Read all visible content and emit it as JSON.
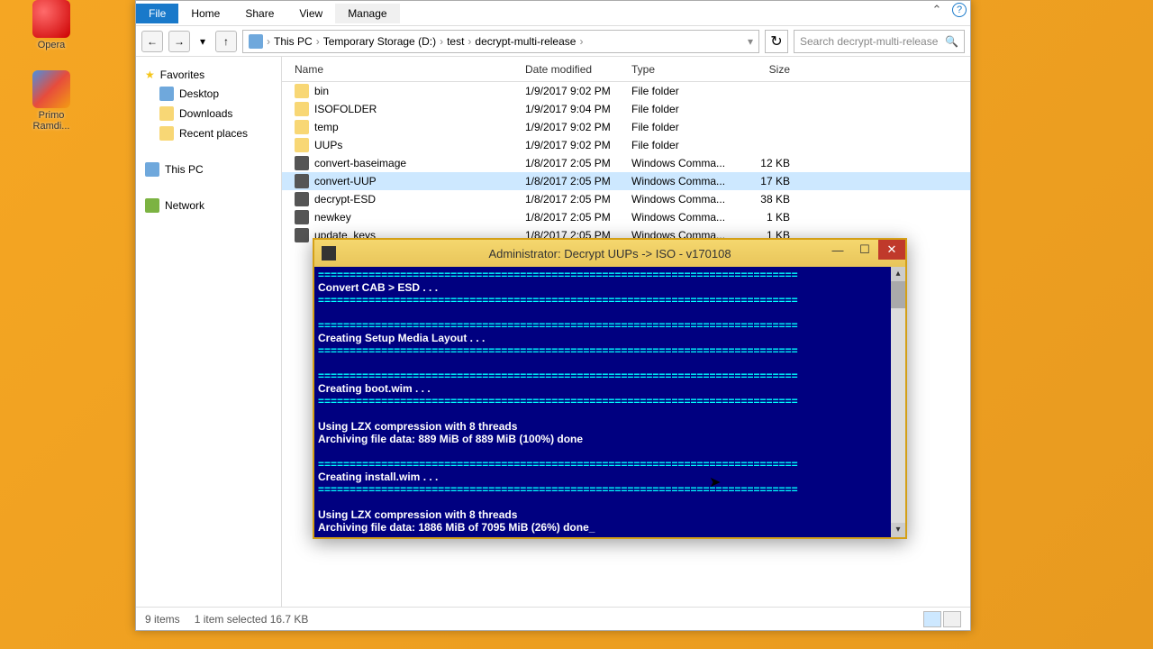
{
  "desktop": {
    "icons": [
      {
        "label": "Opera"
      },
      {
        "label": "Primo Ramdi..."
      }
    ]
  },
  "explorer": {
    "ribbon": {
      "file": "File",
      "home": "Home",
      "share": "Share",
      "view": "View",
      "manage": "Manage"
    },
    "breadcrumb": [
      "This PC",
      "Temporary Storage (D:)",
      "test",
      "decrypt-multi-release"
    ],
    "search_placeholder": "Search decrypt-multi-release",
    "columns": {
      "name": "Name",
      "date": "Date modified",
      "type": "Type",
      "size": "Size"
    },
    "nav": {
      "favorites": "Favorites",
      "desktop": "Desktop",
      "downloads": "Downloads",
      "recent": "Recent places",
      "thispc": "This PC",
      "network": "Network"
    },
    "files": [
      {
        "name": "bin",
        "date": "1/9/2017 9:02 PM",
        "type": "File folder",
        "size": ""
      },
      {
        "name": "ISOFOLDER",
        "date": "1/9/2017 9:04 PM",
        "type": "File folder",
        "size": ""
      },
      {
        "name": "temp",
        "date": "1/9/2017 9:02 PM",
        "type": "File folder",
        "size": ""
      },
      {
        "name": "UUPs",
        "date": "1/9/2017 9:02 PM",
        "type": "File folder",
        "size": ""
      },
      {
        "name": "convert-baseimage",
        "date": "1/8/2017 2:05 PM",
        "type": "Windows Comma...",
        "size": "12 KB"
      },
      {
        "name": "convert-UUP",
        "date": "1/8/2017 2:05 PM",
        "type": "Windows Comma...",
        "size": "17 KB"
      },
      {
        "name": "decrypt-ESD",
        "date": "1/8/2017 2:05 PM",
        "type": "Windows Comma...",
        "size": "38 KB"
      },
      {
        "name": "newkey",
        "date": "1/8/2017 2:05 PM",
        "type": "Windows Comma...",
        "size": "1 KB"
      },
      {
        "name": "update_keys",
        "date": "1/8/2017 2:05 PM",
        "type": "Windows Comma...",
        "size": "1 KB"
      }
    ],
    "status": {
      "items": "9 items",
      "selected": "1 item selected  16.7 KB"
    }
  },
  "cmd": {
    "title": "Administrator:  Decrypt UUPs -> ISO - v170108",
    "lines": [
      "============================================================================",
      "Convert CAB > ESD . . .",
      "============================================================================",
      "",
      "============================================================================",
      "Creating Setup Media Layout . . .",
      "============================================================================",
      "",
      "============================================================================",
      "Creating boot.wim . . .",
      "============================================================================",
      "",
      "Using LZX compression with 8 threads",
      "Archiving file data: 889 MiB of 889 MiB (100%) done",
      "",
      "============================================================================",
      "Creating install.wim . . .",
      "============================================================================",
      "",
      "Using LZX compression with 8 threads",
      "Archiving file data: 1886 MiB of 7095 MiB (26%) done_"
    ]
  }
}
